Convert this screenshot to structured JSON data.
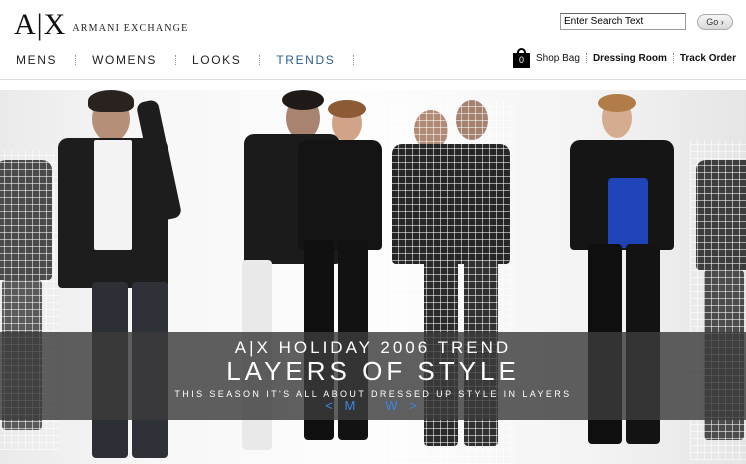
{
  "brand": {
    "mark": "A|X",
    "name": "ARMANI EXCHANGE"
  },
  "search": {
    "placeholder": "Enter Search Text",
    "value": "Enter Search Text",
    "button_label": "Go ›"
  },
  "nav": {
    "items": [
      {
        "label": "MENS",
        "active": false
      },
      {
        "label": "WOMENS",
        "active": false
      },
      {
        "label": "LOOKS",
        "active": false
      },
      {
        "label": "TRENDS",
        "active": true
      }
    ]
  },
  "utility": {
    "bag_count": "0",
    "shop_bag": "Shop Bag",
    "dressing_room": "Dressing Room",
    "track_order": "Track Order"
  },
  "hero": {
    "headline_small": "A|X HOLIDAY 2006 TREND",
    "headline_large": "LAYERS OF STYLE",
    "tagline": "THIS SEASON IT'S ALL ABOUT DRESSED UP STYLE IN LAYERS",
    "link_men": "< M",
    "link_women": "W >"
  },
  "colors": {
    "accent_blue": "#3b86e6",
    "nav_active": "#2a5f8e",
    "banner_bg": "#3c3c3c"
  }
}
